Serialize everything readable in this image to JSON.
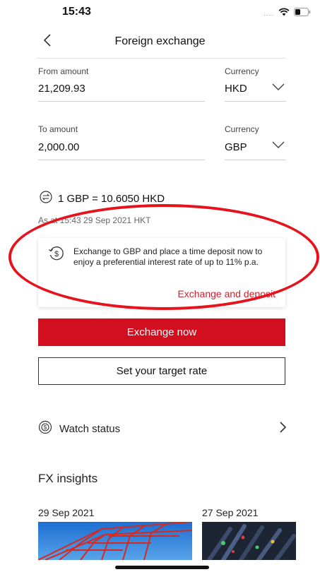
{
  "status_bar": {
    "time": "15:43",
    "signal": "....",
    "wifi_icon": "wifi-icon",
    "battery_icon": "battery-icon"
  },
  "nav": {
    "title": "Foreign exchange",
    "back_icon": "chevron-left-icon"
  },
  "from": {
    "label": "From amount",
    "value": "21,209.93",
    "currency_label": "Currency",
    "currency": "HKD"
  },
  "to": {
    "label": "To amount",
    "value": "2,000.00",
    "currency_label": "Currency",
    "currency": "GBP"
  },
  "rate": {
    "text": "1 GBP = 10.6050 HKD",
    "as_at": "As at 15:43 29 Sep 2021 HKT"
  },
  "promo": {
    "text": "Exchange to GBP and place a time deposit now to enjoy a preferential interest rate of up to 11% p.a.",
    "link": "Exchange and deposit"
  },
  "buttons": {
    "exchange_now": "Exchange now",
    "target_rate": "Set your target rate"
  },
  "watch": {
    "label": "Watch status"
  },
  "insights": {
    "title": "FX insights",
    "items": [
      {
        "date": "29 Sep 2021"
      },
      {
        "date": "27 Sep 2021"
      }
    ]
  },
  "colors": {
    "brand_red": "#d10f1f",
    "link_red": "#d1212e",
    "annotation_red": "#e6121c"
  }
}
